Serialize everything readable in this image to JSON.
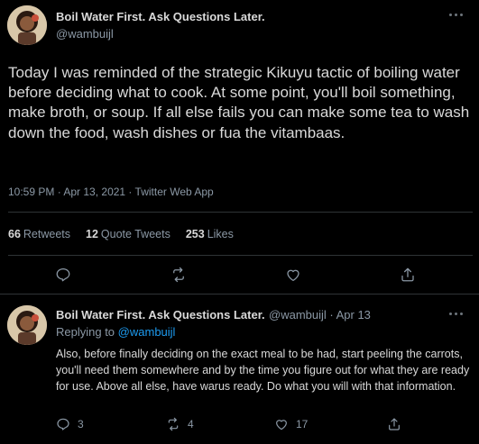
{
  "main_tweet": {
    "display_name": "Boil Water First. Ask Questions Later.",
    "handle": "@wambuijl",
    "text": "Today I was reminded of the strategic Kikuyu tactic of boiling water before deciding what to cook. At some point, you'll boil something, make broth, or soup. If all else fails you can make some tea to wash down the food, wash dishes or fua the vitambaas.",
    "timestamp": "10:59 PM · Apr 13, 2021 · Twitter Web App",
    "stats": {
      "retweets_count": "66",
      "retweets_label": "Retweets",
      "quotes_count": "12",
      "quotes_label": "Quote Tweets",
      "likes_count": "253",
      "likes_label": "Likes"
    },
    "actions": [
      "reply-icon",
      "retweet-icon",
      "like-icon",
      "share-icon"
    ]
  },
  "reply_tweet": {
    "display_name": "Boil Water First. Ask Questions Later.",
    "handle_and_date": "@wambuijl · Apr 13",
    "replying_prefix": "Replying to",
    "replying_to": "@wambuijl",
    "text": "Also, before finally deciding on the exact meal to be had, start peeling the carrots, you'll need them somewhere and by the time you figure out for what they are ready for use. Above all else, have warus ready. Do what you will with that information.",
    "actions": {
      "reply_count": "3",
      "retweet_count": "4",
      "like_count": "17"
    }
  },
  "colors": {
    "background": "#000000",
    "text": "#d9d9d9",
    "muted": "#8b98a5",
    "link": "#1d9bf0",
    "divider": "#2f3336"
  }
}
